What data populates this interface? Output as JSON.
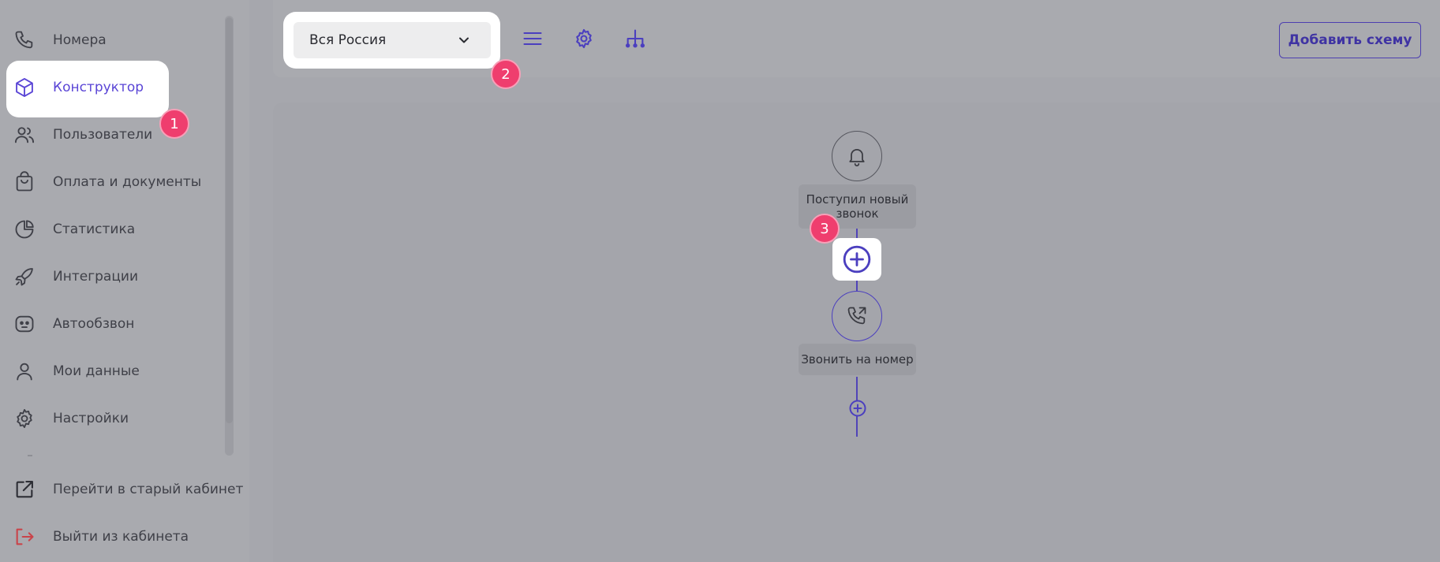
{
  "sidebar": {
    "items": [
      {
        "label": "Номера",
        "icon": "phone-icon"
      },
      {
        "label": "Конструктор",
        "icon": "cube-icon"
      },
      {
        "label": "Пользователи",
        "icon": "users-icon"
      },
      {
        "label": "Оплата и документы",
        "icon": "shopping-bag-icon"
      },
      {
        "label": "Статистика",
        "icon": "pie-chart-icon"
      },
      {
        "label": "Интеграции",
        "icon": "rocket-icon"
      },
      {
        "label": "Автообзвон",
        "icon": "robot-icon"
      },
      {
        "label": "Мои данные",
        "icon": "user-icon"
      },
      {
        "label": "Настройки",
        "icon": "gear-icon"
      }
    ],
    "bottom": [
      {
        "label": "Перейти в старый кабинет",
        "icon": "external-link-icon"
      },
      {
        "label": "Выйти из кабинета",
        "icon": "logout-icon"
      }
    ],
    "active": "Конструктор"
  },
  "toolbar": {
    "region_value": "Вся Россия",
    "add_scheme_label": "Добавить схему",
    "icons": [
      "list-icon",
      "settings-icon",
      "hierarchy-icon"
    ]
  },
  "badges": [
    "1",
    "2",
    "3"
  ],
  "flow": {
    "trigger_label": "Поступил новый звонок",
    "trigger_icon": "bell-icon",
    "action_label": "Звонить на номер",
    "action_icon": "phone-outgoing-icon"
  },
  "colors": {
    "accent": "#5a45d6",
    "badge": "#ef3e6e",
    "logout": "#d2474b"
  }
}
